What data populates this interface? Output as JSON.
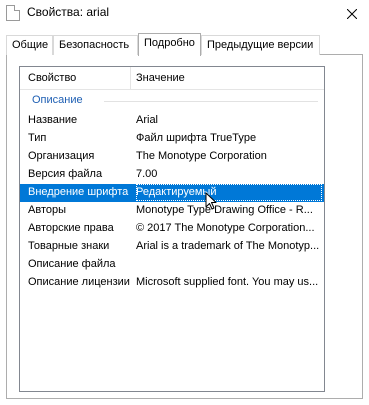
{
  "window": {
    "title": "Свойства: arial"
  },
  "tabs": [
    {
      "label": "Общие",
      "active": false
    },
    {
      "label": "Безопасность",
      "active": false
    },
    {
      "label": "Подробно",
      "active": true
    },
    {
      "label": "Предыдущие версии",
      "active": false
    }
  ],
  "table": {
    "columns": {
      "property": "Свойство",
      "value": "Значение"
    },
    "group": "Описание",
    "rows": [
      {
        "name": "Название",
        "value": "Arial"
      },
      {
        "name": "Тип",
        "value": "Файл шрифта TrueType"
      },
      {
        "name": "Организация",
        "value": "The Monotype Corporation"
      },
      {
        "name": "Версия файла",
        "value": "7.00"
      },
      {
        "name": "Внедрение шрифта",
        "value": "Редактируемый",
        "selected": true
      },
      {
        "name": "Авторы",
        "value": "Monotype Type Drawing Office - R..."
      },
      {
        "name": "Авторские права",
        "value": "© 2017 The Monotype Corporation..."
      },
      {
        "name": "Товарные знаки",
        "value": "Arial is a trademark of The Monotyp..."
      },
      {
        "name": "Описание файла",
        "value": ""
      },
      {
        "name": "Описание лицензии",
        "value": "Microsoft supplied font. You may us..."
      }
    ]
  },
  "colors": {
    "selection": "#0078d7",
    "group_header": "#1e5fb3"
  },
  "icons": {
    "app": "document-icon",
    "close": "close-icon",
    "cursor": "mouse-pointer-icon"
  }
}
